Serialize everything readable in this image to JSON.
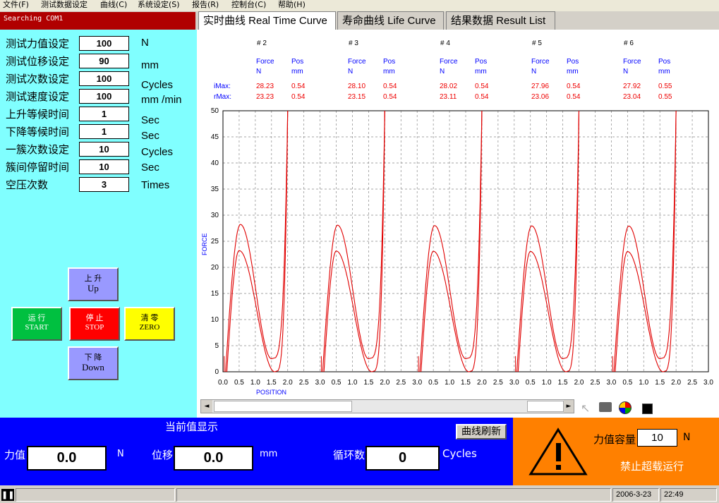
{
  "menu": [
    "文件(F)",
    "测试数据设定",
    "曲线(C)",
    "系统设定(S)",
    "报告(R)",
    "控制台(C)",
    "帮助(H)"
  ],
  "status_left": "Searching COM1",
  "params": [
    {
      "label": "测试力值设定",
      "value": "100",
      "unit": "N"
    },
    {
      "label": "测试位移设定",
      "value": "90",
      "unit": "mm"
    },
    {
      "label": "测试次数设定",
      "value": "100",
      "unit": "Cycles"
    },
    {
      "label": "测试速度设定",
      "value": "100",
      "unit": "mm /min"
    },
    {
      "label": "上升等候时间",
      "value": "1",
      "unit": "Sec"
    },
    {
      "label": "下降等候时间",
      "value": "1",
      "unit": "Sec"
    },
    {
      "label": "一簇次数设定",
      "value": "10",
      "unit": "Cycles"
    },
    {
      "label": "簇间停留时间",
      "value": "10",
      "unit": "Sec"
    },
    {
      "label": "空压次数",
      "value": "3",
      "unit": "Times"
    }
  ],
  "controls": {
    "up": {
      "cn": "上 升",
      "en": "Up"
    },
    "run": {
      "cn": "运 行",
      "en": "START"
    },
    "stop": {
      "cn": "停 止",
      "en": "STOP"
    },
    "zero": {
      "cn": "清 零",
      "en": "ZERO"
    },
    "down": {
      "cn": "下 降",
      "en": "Down"
    }
  },
  "tabs": [
    "实时曲线 Real Time Curve",
    "寿命曲线 Life Curve",
    "结果数据 Result List"
  ],
  "samples_header": {
    "force": "Force",
    "pos": "Pos",
    "force_unit": "N",
    "pos_unit": "mm",
    "imax_label": "iMax:",
    "rmax_label": "rMax:"
  },
  "samples": [
    {
      "id": "# 2",
      "imax_force": "28.23",
      "imax_pos": "0.54",
      "rmax_force": "23.23",
      "rmax_pos": "0.54"
    },
    {
      "id": "# 3",
      "imax_force": "28.10",
      "imax_pos": "0.54",
      "rmax_force": "23.15",
      "rmax_pos": "0.54"
    },
    {
      "id": "# 4",
      "imax_force": "28.02",
      "imax_pos": "0.54",
      "rmax_force": "23.11",
      "rmax_pos": "0.54"
    },
    {
      "id": "# 5",
      "imax_force": "27.96",
      "imax_pos": "0.54",
      "rmax_force": "23.06",
      "rmax_pos": "0.54"
    },
    {
      "id": "# 6",
      "imax_force": "27.92",
      "imax_pos": "0.55",
      "rmax_force": "23.04",
      "rmax_pos": "0.55"
    }
  ],
  "chart_data": {
    "type": "line",
    "xlabel": "POSITION",
    "ylabel": "FORCE",
    "ylim": [
      0,
      50
    ],
    "yticks": [
      0,
      5,
      10,
      15,
      20,
      25,
      30,
      35,
      40,
      45,
      50
    ],
    "xticks_per_panel": [
      "0.0",
      "0.5",
      "1.0",
      "1.5",
      "2.0",
      "2.5",
      "3.0"
    ],
    "xlim_per_panel": [
      0,
      3.0
    ],
    "panels": 5,
    "grid": true,
    "series_peaks": {
      "upper": [
        28.23,
        28.1,
        28.02,
        27.96,
        27.92
      ],
      "lower": [
        23.23,
        23.15,
        23.11,
        23.06,
        23.04
      ]
    },
    "curve_color": "#e00000"
  },
  "bottom": {
    "title": "当前值显示",
    "refresh_button": "曲线刷新",
    "force_label": "力值",
    "force_value": "0.0",
    "force_unit": "N",
    "disp_label": "位移",
    "disp_value": "0.0",
    "disp_unit": "mm",
    "cycles_label": "循环数",
    "cycles_value": "0",
    "cycles_unit": "Cycles",
    "capacity_label": "力值容量",
    "capacity_value": "10",
    "capacity_unit": "N",
    "overload_text": "禁止超载运行"
  },
  "statusbar": {
    "date": "2006-3-23",
    "time": "22:49"
  }
}
